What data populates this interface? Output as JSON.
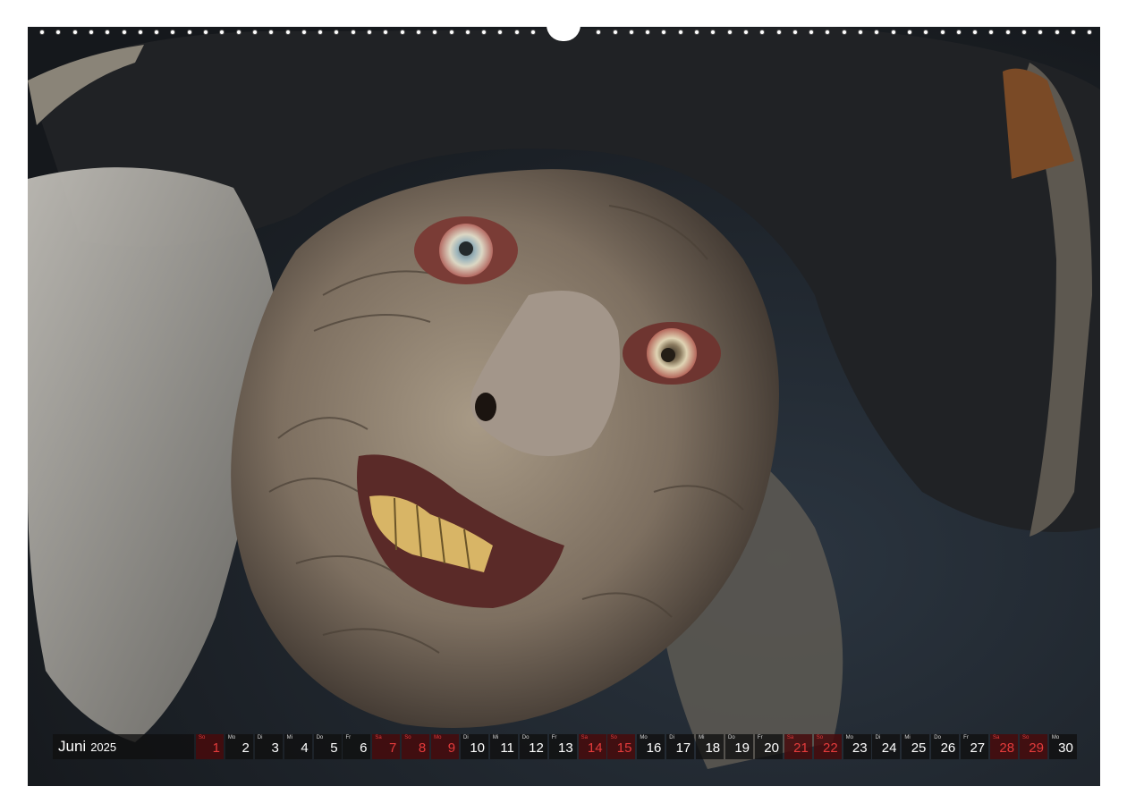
{
  "calendar": {
    "month": "Juni",
    "year": "2025",
    "days": [
      {
        "wd": "So",
        "num": "1",
        "weekend": true
      },
      {
        "wd": "Mo",
        "num": "2",
        "weekend": false
      },
      {
        "wd": "Di",
        "num": "3",
        "weekend": false
      },
      {
        "wd": "Mi",
        "num": "4",
        "weekend": false
      },
      {
        "wd": "Do",
        "num": "5",
        "weekend": false
      },
      {
        "wd": "Fr",
        "num": "6",
        "weekend": false
      },
      {
        "wd": "Sa",
        "num": "7",
        "weekend": true
      },
      {
        "wd": "So",
        "num": "8",
        "weekend": true
      },
      {
        "wd": "Mo",
        "num": "9",
        "weekend": true
      },
      {
        "wd": "Di",
        "num": "10",
        "weekend": false
      },
      {
        "wd": "Mi",
        "num": "11",
        "weekend": false
      },
      {
        "wd": "Do",
        "num": "12",
        "weekend": false
      },
      {
        "wd": "Fr",
        "num": "13",
        "weekend": false
      },
      {
        "wd": "Sa",
        "num": "14",
        "weekend": true
      },
      {
        "wd": "So",
        "num": "15",
        "weekend": true
      },
      {
        "wd": "Mo",
        "num": "16",
        "weekend": false
      },
      {
        "wd": "Di",
        "num": "17",
        "weekend": false
      },
      {
        "wd": "Mi",
        "num": "18",
        "weekend": false
      },
      {
        "wd": "Do",
        "num": "19",
        "weekend": false
      },
      {
        "wd": "Fr",
        "num": "20",
        "weekend": false
      },
      {
        "wd": "Sa",
        "num": "21",
        "weekend": true
      },
      {
        "wd": "So",
        "num": "22",
        "weekend": true
      },
      {
        "wd": "Mo",
        "num": "23",
        "weekend": false
      },
      {
        "wd": "Di",
        "num": "24",
        "weekend": false
      },
      {
        "wd": "Mi",
        "num": "25",
        "weekend": false
      },
      {
        "wd": "Do",
        "num": "26",
        "weekend": false
      },
      {
        "wd": "Fr",
        "num": "27",
        "weekend": false
      },
      {
        "wd": "Sa",
        "num": "28",
        "weekend": true
      },
      {
        "wd": "So",
        "num": "29",
        "weekend": true
      },
      {
        "wd": "Mo",
        "num": "30",
        "weekend": false
      }
    ]
  },
  "colors": {
    "weekend_red": "#e43b3b",
    "strip_dark": "#0f0f0f",
    "background": "#1f2126"
  }
}
